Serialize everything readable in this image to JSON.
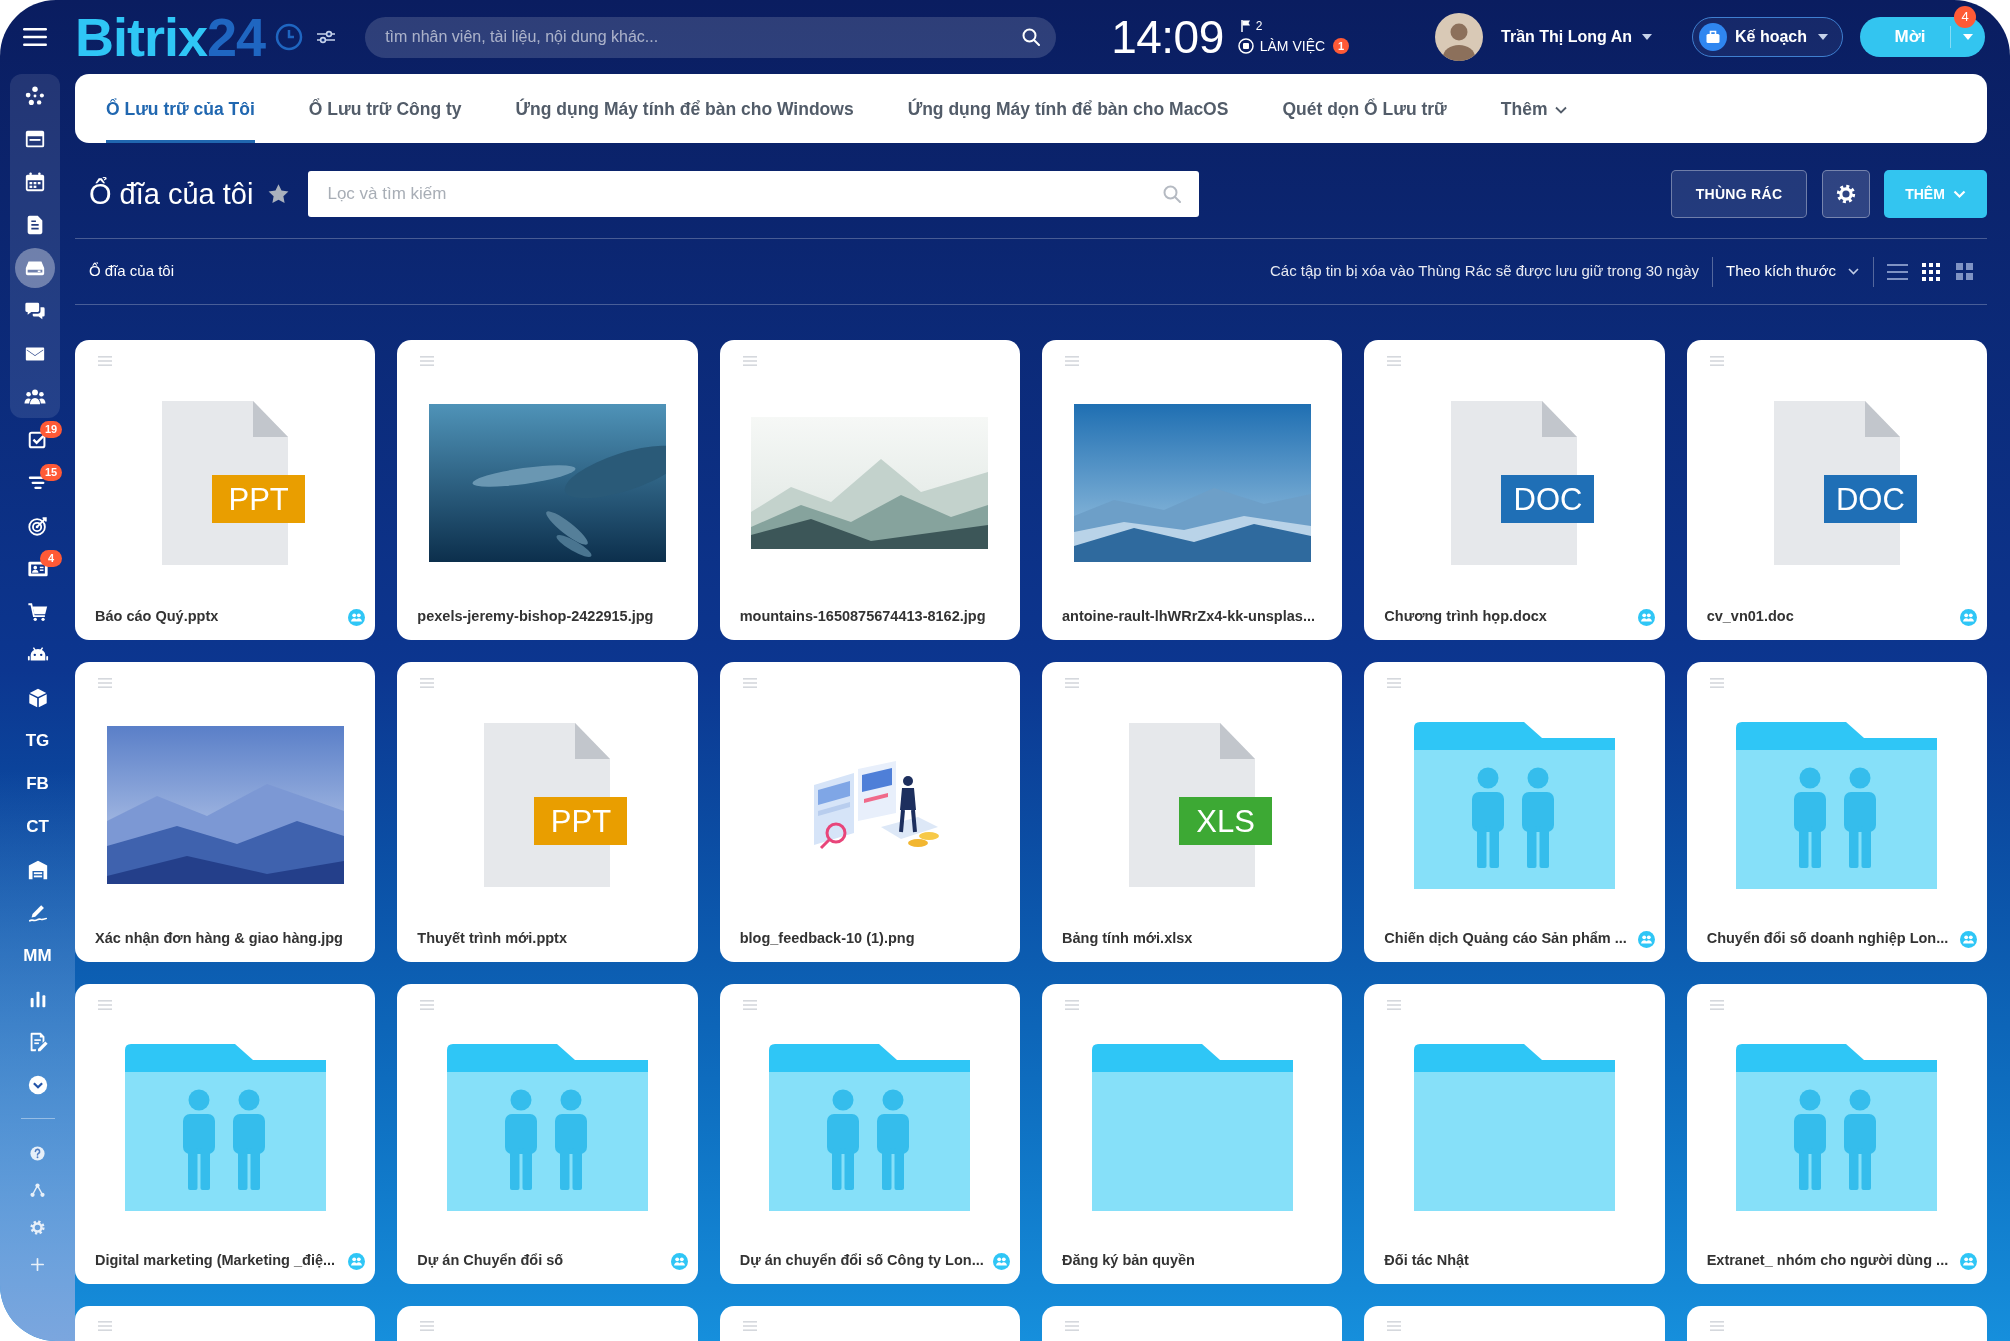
{
  "header": {
    "logo": {
      "word": "Bitrix",
      "number": "24"
    },
    "search": {
      "placeholder": "tìm nhân viên, tài liệu, nội dung khác..."
    },
    "clock": {
      "time": "14:09",
      "flag_count": "2",
      "status": "LÀM VIỆC",
      "status_badge": "1"
    },
    "user": {
      "name": "Trần Thị Long An"
    },
    "plan_button": {
      "label": "Kế hoạch"
    },
    "invite_button": {
      "label": "Mời",
      "badge": "4"
    }
  },
  "sidebar": {
    "pinned_items": [
      {
        "kind": "icon",
        "selected": false
      },
      {
        "kind": "icon",
        "selected": false
      },
      {
        "kind": "icon",
        "selected": false
      },
      {
        "kind": "icon",
        "selected": false
      },
      {
        "kind": "icon",
        "selected": true
      },
      {
        "kind": "icon",
        "selected": false
      },
      {
        "kind": "icon",
        "selected": false
      },
      {
        "kind": "icon",
        "selected": false
      }
    ],
    "items": [
      {
        "kind": "icon",
        "selected": false,
        "badge": "19"
      },
      {
        "kind": "icon",
        "selected": false,
        "badge": "15"
      },
      {
        "kind": "icon",
        "selected": false
      },
      {
        "kind": "icon",
        "selected": false,
        "badge": "4"
      },
      {
        "kind": "icon",
        "selected": false
      },
      {
        "kind": "icon",
        "selected": false
      },
      {
        "kind": "icon",
        "selected": false
      },
      {
        "kind": "text",
        "label": "TG",
        "selected": false
      },
      {
        "kind": "text",
        "label": "FB",
        "selected": false
      },
      {
        "kind": "text",
        "label": "CT",
        "selected": false
      },
      {
        "kind": "icon",
        "selected": false
      },
      {
        "kind": "icon",
        "selected": false
      },
      {
        "kind": "text",
        "label": "MM",
        "selected": false
      },
      {
        "kind": "icon",
        "selected": false
      },
      {
        "kind": "icon",
        "selected": false
      },
      {
        "kind": "icon",
        "selected": false
      }
    ],
    "footer_items": [
      {
        "kind": "icon"
      },
      {
        "kind": "icon"
      },
      {
        "kind": "icon"
      },
      {
        "kind": "icon"
      }
    ]
  },
  "tabs": [
    {
      "label": "Ổ Lưu trữ của Tôi",
      "selected": true,
      "dropdown": false
    },
    {
      "label": "Ổ Lưu trữ Công ty",
      "selected": false,
      "dropdown": false
    },
    {
      "label": "Ứng dụng Máy tính để bàn cho Windows",
      "selected": false,
      "dropdown": false
    },
    {
      "label": "Ứng dụng Máy tính để bàn cho MacOS",
      "selected": false,
      "dropdown": false
    },
    {
      "label": "Quét dọn Ổ Lưu trữ",
      "selected": false,
      "dropdown": false
    },
    {
      "label": "Thêm",
      "selected": false,
      "dropdown": true
    }
  ],
  "toolbar": {
    "title": "Ổ đĩa của tôi",
    "favorited": false,
    "filter": {
      "placeholder": "Lọc và tìm kiếm"
    },
    "trash_button": {
      "label": "THÙNG RÁC"
    },
    "add_button": {
      "label": "THÊM"
    }
  },
  "path_bar": {
    "breadcrumbs": [
      "Ổ đĩa của tôi"
    ],
    "notice": "Các tập tin bị xóa vào Thùng Rác sẽ được lưu giữ trong 30 ngày",
    "sort": {
      "label": "Theo kích thước"
    },
    "view_modes": [
      {
        "selected": false
      },
      {
        "selected": true
      },
      {
        "selected": false
      }
    ]
  },
  "files": [
    {
      "name": "Báo cáo Quý.pptx",
      "kind": "document",
      "file_type": "PPT",
      "color": "#e99e00",
      "shared": true
    },
    {
      "name": "pexels-jeremy-bishop-2422915.jpg",
      "kind": "photo",
      "shared": false
    },
    {
      "name": "mountains-1650875674413-8162.jpg",
      "kind": "photo",
      "shared": false
    },
    {
      "name": "antoine-rault-lhWRrZx4-kk-unsplas...",
      "kind": "photo",
      "shared": false
    },
    {
      "name": "Chương trình họp.docx",
      "kind": "document",
      "file_type": "DOC",
      "color": "#1f6fb6",
      "shared": true
    },
    {
      "name": "cv_vn01.doc",
      "kind": "document",
      "file_type": "DOC",
      "color": "#1f6fb6",
      "shared": true
    },
    {
      "name": "Xác nhận đơn hàng & giao hàng.jpg",
      "kind": "photo",
      "shared": false
    },
    {
      "name": "Thuyết trình mới.pptx",
      "kind": "document",
      "file_type": "PPT",
      "color": "#e99e00",
      "shared": false
    },
    {
      "name": "blog_feedback-10 (1).png",
      "kind": "illustration",
      "shared": false
    },
    {
      "name": "Bảng tính mới.xlsx",
      "kind": "document",
      "file_type": "XLS",
      "color": "#3da934",
      "shared": false
    },
    {
      "name": "Chiến dịch Quảng cáo Sản phẩm ...",
      "kind": "shared_folder",
      "shared": true
    },
    {
      "name": "Chuyển đổi số doanh nghiệp Lon...",
      "kind": "shared_folder",
      "shared": true
    },
    {
      "name": "Digital marketing (Marketing _điệ...",
      "kind": "shared_folder",
      "shared": true
    },
    {
      "name": "Dự án Chuyển đổi số",
      "kind": "shared_folder",
      "shared": true
    },
    {
      "name": "Dự án chuyển đổi số Công ty Lon...",
      "kind": "shared_folder",
      "shared": true
    },
    {
      "name": "Đăng ký bản quyền",
      "kind": "folder",
      "shared": false
    },
    {
      "name": "Đối tác Nhật",
      "kind": "folder",
      "shared": false
    },
    {
      "name": "Extranet_ nhóm cho người dùng ...",
      "kind": "shared_folder",
      "shared": true
    },
    {
      "kind": "cut_off"
    },
    {
      "kind": "cut_off"
    },
    {
      "kind": "cut_off"
    },
    {
      "kind": "cut_off"
    },
    {
      "kind": "cut_off"
    },
    {
      "kind": "cut_off"
    }
  ]
}
